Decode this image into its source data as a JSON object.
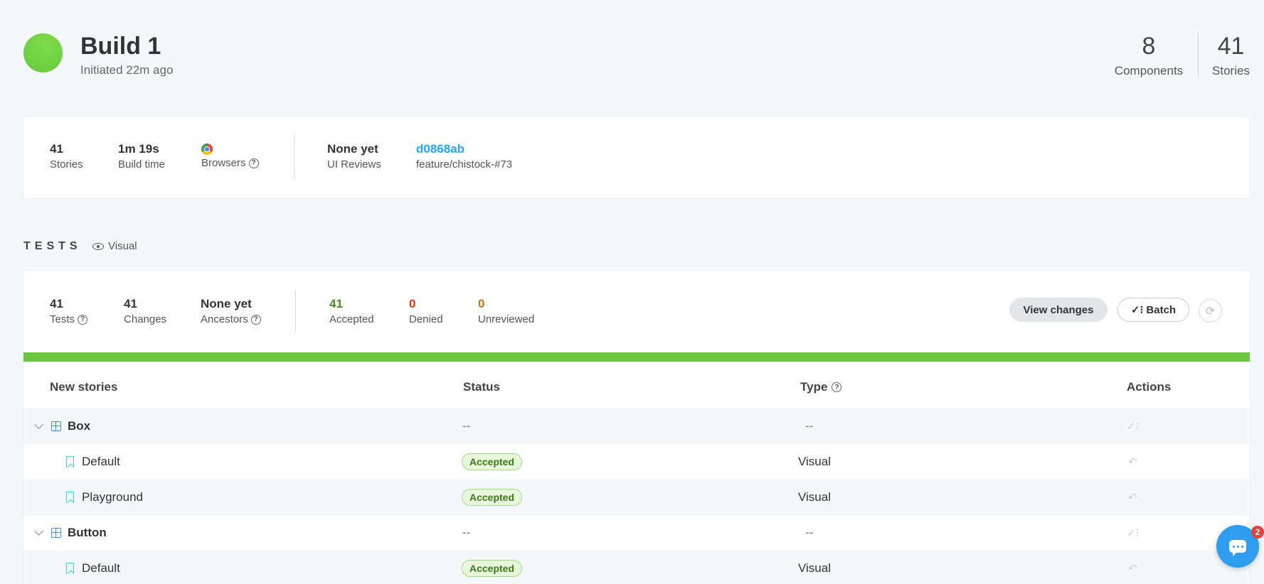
{
  "build": {
    "title": "Build 1",
    "subtitle": "Initiated 22m ago",
    "status_color": "#6cc644"
  },
  "summary": {
    "components_count": "8",
    "components_label": "Components",
    "stories_count": "41",
    "stories_label": "Stories"
  },
  "info": {
    "stories_value": "41",
    "stories_label": "Stories",
    "build_time_value": "1m 19s",
    "build_time_label": "Build time",
    "browsers_icon": "chrome-icon",
    "browsers_label": "Browsers",
    "ui_reviews_value": "None yet",
    "ui_reviews_label": "UI Reviews",
    "commit": "d0868ab",
    "branch": "feature/chistock-#73"
  },
  "tests": {
    "heading": "TESTS",
    "mode": "Visual",
    "tests_value": "41",
    "tests_label": "Tests",
    "changes_value": "41",
    "changes_label": "Changes",
    "ancestors_value": "None yet",
    "ancestors_label": "Ancestors",
    "accepted_value": "41",
    "accepted_label": "Accepted",
    "denied_value": "0",
    "denied_label": "Denied",
    "unreviewed_value": "0",
    "unreviewed_label": "Unreviewed",
    "view_changes_label": "View changes",
    "batch_label": "✓⁝ Batch",
    "progress_accepted_fraction": 1.0
  },
  "table": {
    "columns": {
      "name": "New stories",
      "status": "Status",
      "type": "Type",
      "actions": "Actions"
    },
    "rows": [
      {
        "kind": "group",
        "name": "Box",
        "status": "--",
        "type": "--"
      },
      {
        "kind": "story",
        "name": "Default",
        "status": "Accepted",
        "type": "Visual"
      },
      {
        "kind": "story",
        "name": "Playground",
        "status": "Accepted",
        "type": "Visual"
      },
      {
        "kind": "group",
        "name": "Button",
        "status": "--",
        "type": "--"
      },
      {
        "kind": "story",
        "name": "Default",
        "status": "Accepted",
        "type": "Visual"
      }
    ]
  },
  "chat": {
    "unread": "2"
  }
}
